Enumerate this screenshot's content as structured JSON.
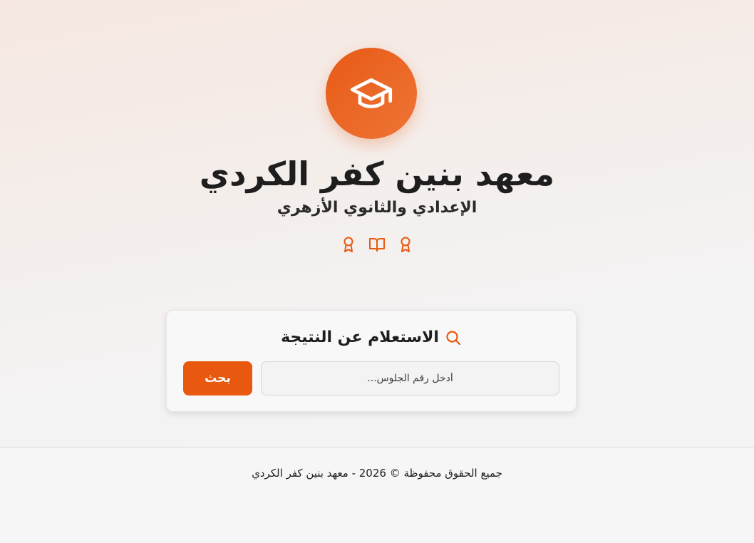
{
  "header": {
    "logo_icon": "graduation-cap-icon",
    "title": "معهد بنين كفر الكردي",
    "subtitle": "الإعدادي والثانوي الأزهري",
    "badge_icons": [
      "award-icon",
      "open-book-icon",
      "award-icon"
    ]
  },
  "search_card": {
    "heading": "الاستعلام عن النتيجة",
    "heading_icon": "search-icon",
    "input_placeholder": "أدخل رقم الجلوس...",
    "input_value": "",
    "button_label": "بحث"
  },
  "footer": {
    "copyright": "جميع الحقوق محفوظة © 2026 - معهد بنين كفر الكردي"
  },
  "colors": {
    "accent": "#e8580f",
    "background": "#f4f4f4",
    "text": "#1e1e1e"
  }
}
